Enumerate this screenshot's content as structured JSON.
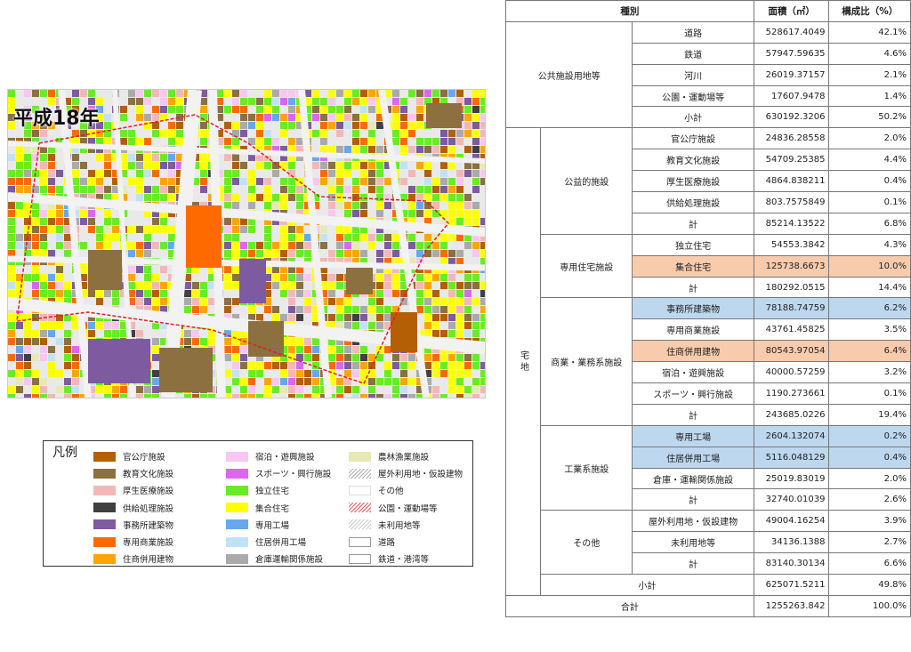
{
  "map": {
    "title": "平成18年"
  },
  "legend": {
    "title": "凡例",
    "items": [
      {
        "label": "官公庁施設",
        "color": "#b45f06",
        "pattern": "solid"
      },
      {
        "label": "教育文化施設",
        "color": "#8c7040",
        "pattern": "solid"
      },
      {
        "label": "厚生医療施設",
        "color": "#f4b6b6",
        "pattern": "solid"
      },
      {
        "label": "供給処理施設",
        "color": "#404040",
        "pattern": "solid"
      },
      {
        "label": "事務所建築物",
        "color": "#7e5aa0",
        "pattern": "solid"
      },
      {
        "label": "専用商業施設",
        "color": "#ff6a00",
        "pattern": "solid"
      },
      {
        "label": "住商併用建物",
        "color": "#ffa500",
        "pattern": "solid"
      },
      {
        "label": "宿泊・遊興施設",
        "color": "#f8c6f0",
        "pattern": "solid"
      },
      {
        "label": "スポーツ・興行施設",
        "color": "#dd66ee",
        "pattern": "solid"
      },
      {
        "label": "独立住宅",
        "color": "#66ee22",
        "pattern": "solid"
      },
      {
        "label": "集合住宅",
        "color": "#ffff00",
        "pattern": "solid"
      },
      {
        "label": "専用工場",
        "color": "#66a8ee",
        "pattern": "solid"
      },
      {
        "label": "住居併用工場",
        "color": "#bfe3f5",
        "pattern": "solid"
      },
      {
        "label": "倉庫運輸関係施設",
        "color": "#aaaaaa",
        "pattern": "solid"
      },
      {
        "label": "農林漁業施設",
        "color": "#e6e9b4",
        "pattern": "solid"
      },
      {
        "label": "屋外利用地・仮設建物",
        "color": "#b0b0b0",
        "pattern": "hatch"
      },
      {
        "label": "その他",
        "color": "#ffffff",
        "pattern": "solid"
      },
      {
        "label": "公園・運動場等",
        "color": "#e06060",
        "pattern": "hatch"
      },
      {
        "label": "未利用地等",
        "color": "#cccccc",
        "pattern": "hatch"
      },
      {
        "label": "道路",
        "color": "#ffffff",
        "pattern": "outline"
      },
      {
        "label": "鉄道・港湾等",
        "color": "#ffffff",
        "pattern": "outline"
      }
    ]
  },
  "table": {
    "headers": {
      "type": "種別",
      "area": "面積（㎡）",
      "ratio": "構成比（%）"
    },
    "public": {
      "label": "公共施設用地等",
      "rows": [
        {
          "name": "道路",
          "area": "528617.4049",
          "ratio": "42.1%"
        },
        {
          "name": "鉄道",
          "area": "57947.59635",
          "ratio": "4.6%"
        },
        {
          "name": "河川",
          "area": "26019.37157",
          "ratio": "2.1%"
        },
        {
          "name": "公園・運動場等",
          "area": "17607.9478",
          "ratio": "1.4%"
        },
        {
          "name": "小計",
          "area": "630192.3206",
          "ratio": "50.2%"
        }
      ]
    },
    "residential_label": "宅地",
    "groups": [
      {
        "label": "公益的施設",
        "rows": [
          {
            "name": "官公庁施設",
            "area": "24836.28558",
            "ratio": "2.0%",
            "hl": ""
          },
          {
            "name": "教育文化施設",
            "area": "54709.25385",
            "ratio": "4.4%",
            "hl": ""
          },
          {
            "name": "厚生医療施設",
            "area": "4864.838211",
            "ratio": "0.4%",
            "hl": ""
          },
          {
            "name": "供給処理施設",
            "area": "803.7575849",
            "ratio": "0.1%",
            "hl": ""
          },
          {
            "name": "計",
            "area": "85214.13522",
            "ratio": "6.8%",
            "hl": ""
          }
        ]
      },
      {
        "label": "専用住宅施設",
        "rows": [
          {
            "name": "独立住宅",
            "area": "54553.3842",
            "ratio": "4.3%",
            "hl": ""
          },
          {
            "name": "集合住宅",
            "area": "125738.6673",
            "ratio": "10.0%",
            "hl": "o"
          },
          {
            "name": "計",
            "area": "180292.0515",
            "ratio": "14.4%",
            "hl": ""
          }
        ]
      },
      {
        "label": "商業・業務系施設",
        "rows": [
          {
            "name": "事務所建築物",
            "area": "78188.74759",
            "ratio": "6.2%",
            "hl": "b"
          },
          {
            "name": "専用商業施設",
            "area": "43761.45825",
            "ratio": "3.5%",
            "hl": ""
          },
          {
            "name": "住商併用建物",
            "area": "80543.97054",
            "ratio": "6.4%",
            "hl": "o"
          },
          {
            "name": "宿泊・遊興施設",
            "area": "40000.57259",
            "ratio": "3.2%",
            "hl": ""
          },
          {
            "name": "スポーツ・興行施設",
            "area": "1190.273661",
            "ratio": "0.1%",
            "hl": ""
          },
          {
            "name": "計",
            "area": "243685.0226",
            "ratio": "19.4%",
            "hl": ""
          }
        ]
      },
      {
        "label": "工業系施設",
        "rows": [
          {
            "name": "専用工場",
            "area": "2604.132074",
            "ratio": "0.2%",
            "hl": "b"
          },
          {
            "name": "住居併用工場",
            "area": "5116.048129",
            "ratio": "0.4%",
            "hl": "b"
          },
          {
            "name": "倉庫・運輸関係施設",
            "area": "25019.83019",
            "ratio": "2.0%",
            "hl": ""
          },
          {
            "name": "計",
            "area": "32740.01039",
            "ratio": "2.6%",
            "hl": ""
          }
        ]
      },
      {
        "label": "その他",
        "rows": [
          {
            "name": "屋外利用地・仮設建物",
            "area": "49004.16254",
            "ratio": "3.9%",
            "hl": ""
          },
          {
            "name": "未利用地等",
            "area": "34136.1388",
            "ratio": "2.7%",
            "hl": ""
          },
          {
            "name": "計",
            "area": "83140.30134",
            "ratio": "6.6%",
            "hl": ""
          }
        ]
      }
    ],
    "res_subtotal": {
      "name": "小計",
      "area": "625071.5211",
      "ratio": "49.8%"
    },
    "total": {
      "name": "合計",
      "area": "1255263.842",
      "ratio": "100.0%"
    }
  }
}
